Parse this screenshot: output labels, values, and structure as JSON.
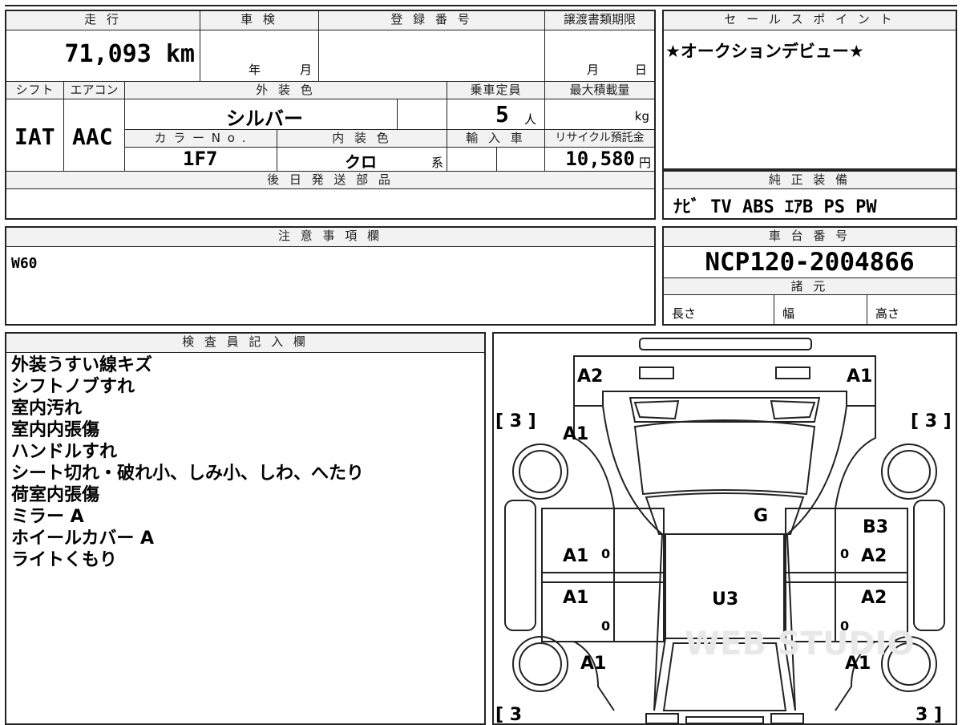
{
  "top_table": {
    "mileage_label": "走 行",
    "mileage_value": "71,093 km",
    "shaken_label": "車 検",
    "shaken_year": "年",
    "shaken_month": "月",
    "registration_label": "登 録 番 号",
    "transfer_label": "譲渡書類期限",
    "transfer_month": "月",
    "transfer_day": "日",
    "shift_label": "シフト",
    "shift_value": "IAT",
    "aircon_label": "エアコン",
    "aircon_value": "AAC",
    "exterior_color_label": "外 装 色",
    "exterior_color_value": "シルバー",
    "capacity_label": "乗車定員",
    "capacity_value": "5",
    "capacity_unit": "人",
    "max_load_label": "最大積載量",
    "max_load_unit": "kg",
    "color_no_label": "カ ラ ー N o .",
    "color_no_value": "1F7",
    "interior_color_label": "内 装 色",
    "interior_color_value": "クロ",
    "interior_color_suffix": "系",
    "import_label": "輸 入 車",
    "recycle_label": "リサイクル預託金",
    "recycle_value": "10,580",
    "recycle_unit": "円",
    "later_parts_label": "後 日 発 送 部 品"
  },
  "sales_point": {
    "label": "セ ー ル ス ポ イ ン ト",
    "text": "★オークションデビュー★"
  },
  "genuine_equipment": {
    "label": "純 正 装 備",
    "text": "ﾅﾋﾞ TV ABS ｴｱB PS PW"
  },
  "caution": {
    "label": "注 意 事 項 欄",
    "text": "W60"
  },
  "chassis": {
    "label": "車 台 番 号",
    "value": "NCP120-2004866"
  },
  "specs": {
    "label": "諸 元",
    "length_label": "長さ",
    "width_label": "幅",
    "height_label": "高さ"
  },
  "inspector": {
    "label": "検 査 員 記 入 欄",
    "notes": [
      "外装うすい線キズ",
      "シフトノブすれ",
      "室内汚れ",
      "室内内張傷",
      "ハンドルすれ",
      "シート切れ・破れ小、しみ小、しわ、へたり",
      "荷室内張傷",
      "ミラー A",
      "ホイールカバー A",
      "ライトくもり"
    ]
  },
  "diagram": {
    "watermark": "WEB STUDIO",
    "marks": {
      "rear_left": "A2",
      "rear_right": "A1",
      "rear_left_quarter": "A1",
      "roof": "G",
      "right_rear_door_upper": "B3",
      "left_rear_door": "A1",
      "right_rear_door": "A2",
      "left_front_door": "A1",
      "center": "U3",
      "right_front_door": "A2",
      "left_front_fender": "A1",
      "right_front_fender": "A1",
      "door_zero_1": "0",
      "door_zero_2": "0",
      "door_zero_3": "0",
      "door_zero_4": "0"
    },
    "tire_tl": "[ 3 ]",
    "tire_tr": "[ 3 ]",
    "tire_bl": "[ 3",
    "tire_br": "3 ]"
  }
}
